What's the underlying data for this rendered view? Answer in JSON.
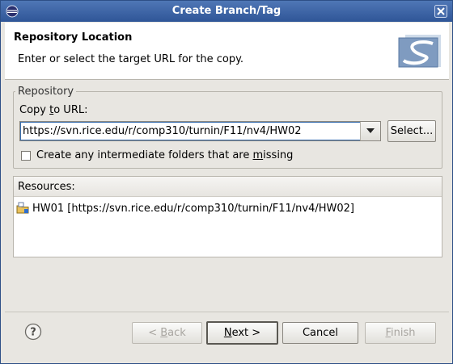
{
  "window": {
    "title": "Create Branch/Tag"
  },
  "header": {
    "title": "Repository Location",
    "description": "Enter or select the target URL for the copy."
  },
  "repository": {
    "group_label": "Repository",
    "copy_label_pre": "Copy ",
    "copy_label_mnemonic": "t",
    "copy_label_post": "o URL:",
    "url_value": "https://svn.rice.edu/r/comp310/turnin/F11/nv4/HW02",
    "select_label": "Select...",
    "checkbox_label_pre": "Create any intermediate folders that are ",
    "checkbox_label_mnemonic": "m",
    "checkbox_label_post": "issing",
    "checkbox_checked": false
  },
  "resources": {
    "header": "Resources:",
    "items": [
      {
        "label": "HW01 [https://svn.rice.edu/r/comp310/turnin/F11/nv4/HW02]",
        "icon": "project-folder-icon"
      }
    ]
  },
  "buttons": {
    "back_pre": "< ",
    "back_mnemonic": "B",
    "back_post": "ack",
    "next_mnemonic": "N",
    "next_post": "ext >",
    "cancel": "Cancel",
    "finish_mnemonic": "F",
    "finish_post": "inish"
  },
  "colors": {
    "titlebar": "#2f5597",
    "dialog_bg": "#e8e6e1",
    "header_bg": "#ffffff"
  }
}
